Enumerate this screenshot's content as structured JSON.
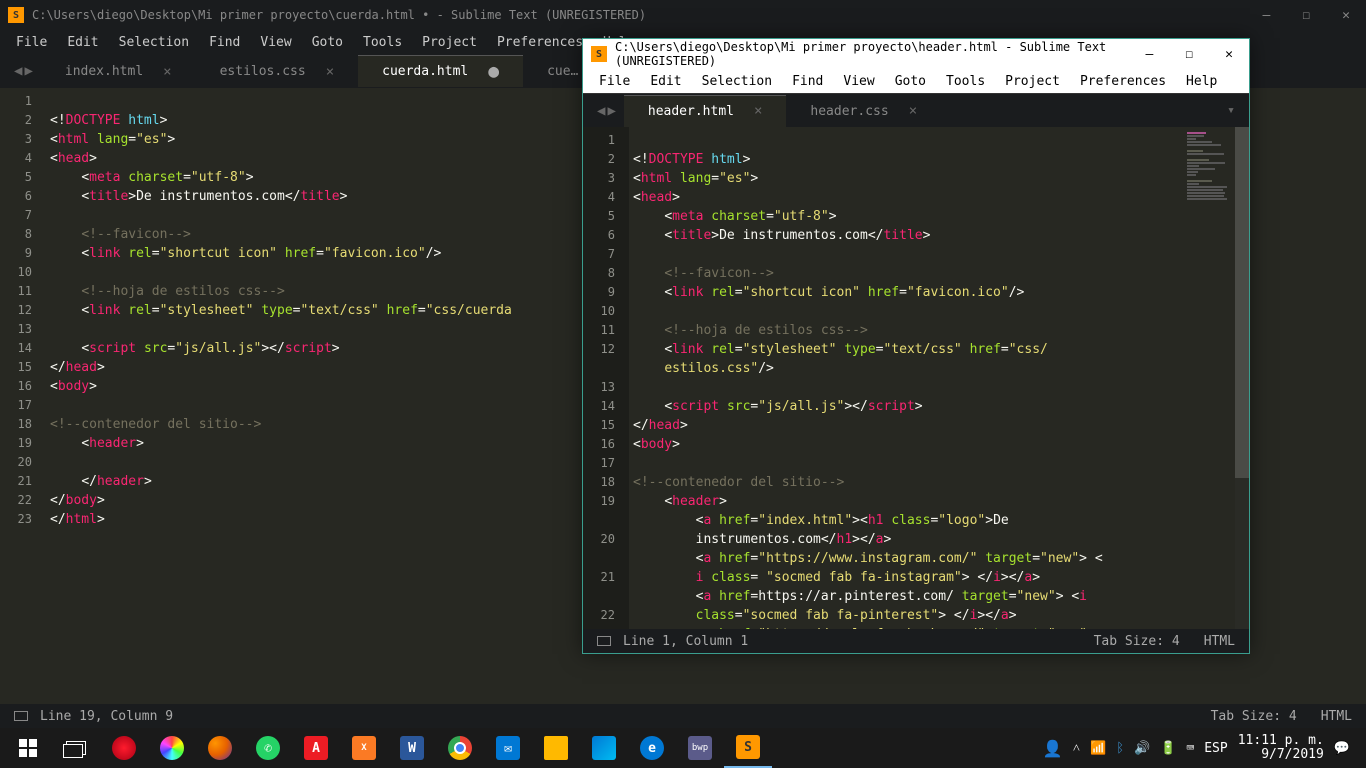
{
  "win1": {
    "title": "C:\\Users\\diego\\Desktop\\Mi primer proyecto\\cuerda.html • - Sublime Text (UNREGISTERED)",
    "menu": [
      "File",
      "Edit",
      "Selection",
      "Find",
      "View",
      "Goto",
      "Tools",
      "Project",
      "Preferences",
      "Help"
    ],
    "tabs": [
      {
        "label": "index.html",
        "close": "×"
      },
      {
        "label": "estilos.css",
        "close": "×"
      },
      {
        "label": "cuerda.html",
        "close": "●",
        "active": true
      },
      {
        "label": "cue…",
        "close": ""
      }
    ],
    "lines": [
      "1",
      "2",
      "3",
      "4",
      "5",
      "6",
      "7",
      "8",
      "9",
      "10",
      "11",
      "12",
      "13",
      "14",
      "15",
      "16",
      "17",
      "18",
      "19",
      "20",
      "21",
      "22",
      "23"
    ],
    "status_left": "Line 19, Column 9",
    "status_tab": "Tab Size: 4",
    "status_lang": "HTML"
  },
  "win2": {
    "title": "C:\\Users\\diego\\Desktop\\Mi primer proyecto\\header.html - Sublime Text (UNREGISTERED)",
    "menu": [
      "File",
      "Edit",
      "Selection",
      "Find",
      "View",
      "Goto",
      "Tools",
      "Project",
      "Preferences",
      "Help"
    ],
    "tabs": [
      {
        "label": "header.html",
        "close": "×",
        "active": true
      },
      {
        "label": "header.css",
        "close": "×"
      }
    ],
    "lines": [
      "1",
      "2",
      "3",
      "4",
      "5",
      "6",
      "7",
      "8",
      "9",
      "10",
      "11",
      "12",
      "",
      "13",
      "14",
      "15",
      "16",
      "17",
      "18",
      "19",
      "",
      "20",
      "",
      "21",
      "",
      "22"
    ],
    "status_left": "Line 1, Column 1",
    "status_tab": "Tab Size: 4",
    "status_lang": "HTML"
  },
  "code1": {
    "doctype": "<!DOCTYPE html>",
    "html_open": "html",
    "lang": "lang",
    "lang_v": "\"es\"",
    "head": "head",
    "meta": "meta",
    "charset": "charset",
    "charset_v": "\"utf-8\"",
    "title": "title",
    "title_txt": "De instrumentos.com",
    "cm_favicon": "<!--favicon-->",
    "link": "link",
    "rel": "rel",
    "rel_v1": "\"shortcut icon\"",
    "href": "href",
    "href_v1": "\"favicon.ico\"",
    "cm_hoja": "<!--hoja de estilos css-->",
    "rel_v2": "\"stylesheet\"",
    "type": "type",
    "type_v": "\"text/css\"",
    "href_v2": "\"css/cuerda",
    "script": "script",
    "src": "src",
    "src_v": "\"js/all.js\"",
    "body": "body",
    "cm_cont": "<!--contenedor del sitio-->",
    "header": "header"
  },
  "code2": {
    "href_css": "\"css/",
    "css_file": "estilos.css\"",
    "a": "a",
    "href": "href",
    "href_idx": "\"index.html\"",
    "h1": "h1",
    "class": "class",
    "class_logo": "\"logo\"",
    "logo_txt": "De",
    "logo_txt2": "instrumentos.com",
    "href_ig": "\"https://www.instagram.com/\"",
    "target": "target",
    "target_v": "\"new\"",
    "i": "i",
    "class_ig": "\"socmed fab fa-instagram\"",
    "href_pin": "https://ar.pinterest.com/",
    "class_pin": "\"socmed fab fa-pinterest\"",
    "href_fb": "\"https://es-la.facebook.com/\""
  },
  "taskbar": {
    "time": "11:11 p. m.",
    "date": "9/7/2019",
    "lang": "ESP"
  }
}
